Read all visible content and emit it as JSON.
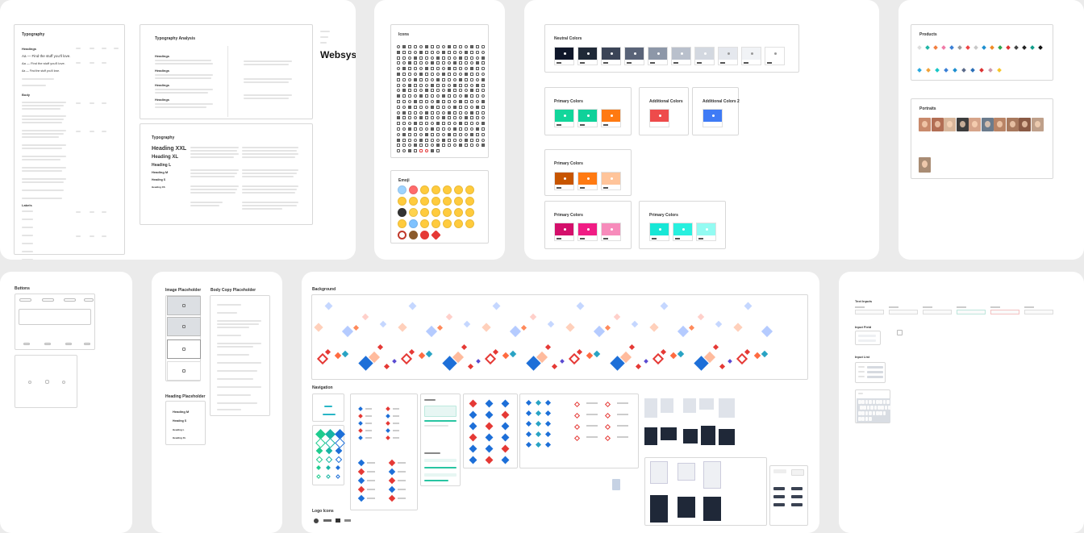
{
  "typography": {
    "title": "Typography",
    "lines": [
      "Aa — Find the stuff you'll love.",
      "Aa — Find the stuff you'll love.",
      "Aa — Find the stuff you'll love."
    ],
    "sections": [
      "Body",
      "Labels"
    ]
  },
  "typo_analysis": {
    "title": "Typography Analysis",
    "headings": [
      "Headings",
      "Headings",
      "Headings",
      "Headings"
    ],
    "brand": "Websys"
  },
  "typo2": {
    "title": "Typography",
    "levels": [
      "Heading XXL",
      "Heading XL",
      "Heading L",
      "Heading M",
      "Heading S",
      "Heading XS"
    ]
  },
  "icons": {
    "title": "Icons"
  },
  "emoji": {
    "title": "Emoji"
  },
  "colors": {
    "neutral_title": "Neutral Colors",
    "primary_title": "Primary Colors",
    "additional_title": "Additional Colors",
    "additional2_title": "Additional Colors 2",
    "neutral": [
      "#0f172a",
      "#1f2937",
      "#3b4457",
      "#596378",
      "#8d97a8",
      "#b9c0cc",
      "#d3d8e0",
      "#e5e8ee",
      "#f1f3f6",
      "#ffffff"
    ],
    "primary_green": [
      "#12d69b",
      "#0fd19a",
      "#ff7a12"
    ],
    "primary_orange": [
      "#c75500",
      "#ff7a12",
      "#ffc49a"
    ],
    "primary_pink": [
      "#d40f6b",
      "#f01c84",
      "#f78bbb"
    ],
    "primary_cyan": [
      "#18e7d6",
      "#28f0df",
      "#93fbf2"
    ],
    "additional_red": "#ee4b4b",
    "additional_blue": "#3f7bf5"
  },
  "products": {
    "title": "Products"
  },
  "portraits": {
    "title": "Portraits"
  },
  "buttons": {
    "title": "Buttons"
  },
  "placeholders": {
    "image_title": "Image Placeholder",
    "body_title": "Body Copy Placeholder",
    "heading_title": "Heading Placeholder",
    "headings": [
      "Heading M",
      "Heading S",
      "Heading L",
      "Heading XL"
    ]
  },
  "background": {
    "title": "Background"
  },
  "navigation": {
    "title": "Navigation"
  },
  "logo": {
    "title": "Logo Icons"
  },
  "inputs": {
    "text_inputs": "Text Inputs",
    "input_field": "Input Field",
    "input_list": "Input List"
  }
}
